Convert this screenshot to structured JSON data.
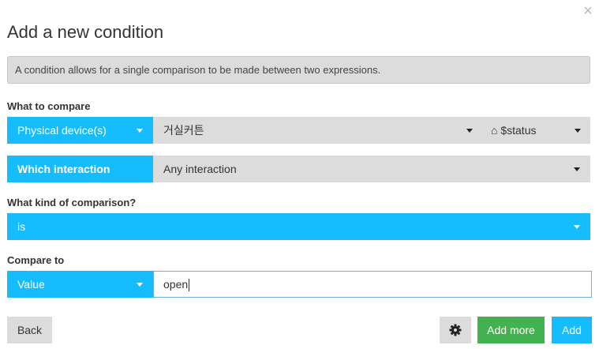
{
  "dialog": {
    "title": "Add a new condition",
    "close_glyph": "×",
    "info": "A condition allows for a single comparison to be made between two expressions."
  },
  "what_to_compare": {
    "label": "What to compare",
    "source_type": "Physical device(s)",
    "device": "거실커튼",
    "property": "⌂ $status"
  },
  "interaction": {
    "label": "Which interaction",
    "value": "Any interaction"
  },
  "comparison": {
    "label": "What kind of comparison?",
    "value": "is"
  },
  "compare_to": {
    "label": "Compare to",
    "type": "Value",
    "value": "open"
  },
  "footer": {
    "back": "Back",
    "add_more": "Add more",
    "add": "Add"
  },
  "icons": {
    "close": "close-icon",
    "gear": "gear-icon",
    "caret": "caret-down-icon"
  },
  "colors": {
    "primary": "#16bdfe",
    "success": "#43b14f",
    "neutral": "#dcdcdc"
  }
}
